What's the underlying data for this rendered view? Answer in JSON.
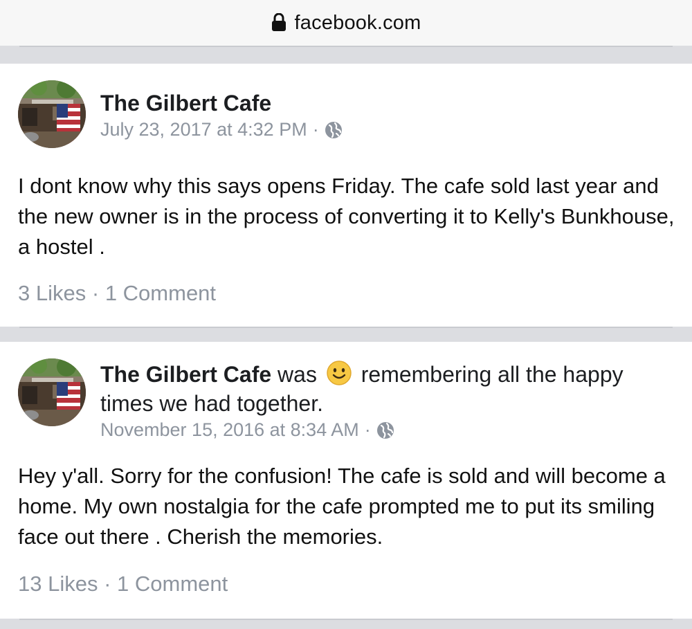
{
  "browser": {
    "url": "facebook.com",
    "lock_icon": "lock-icon"
  },
  "posts": [
    {
      "author": "The Gilbert Cafe",
      "activity": "",
      "activity_rest": "",
      "timestamp": "July 23, 2017 at 4:32 PM",
      "separator": "·",
      "privacy_icon": "globe-icon",
      "body": "I dont know why this says opens Friday. The cafe sold last year and the new owner is in the process of converting it to Kelly's Bunkhouse, a hostel .",
      "likes": "3 Likes",
      "stats_separator": "·",
      "comments": "1 Comment"
    },
    {
      "author": "The Gilbert Cafe",
      "activity": "was",
      "activity_rest": "remembering all the happy times we had together.",
      "feeling_icon": "smiley-face-icon",
      "timestamp": "November 15, 2016 at 8:34 AM",
      "separator": "·",
      "privacy_icon": "globe-icon",
      "body": "Hey y'all. Sorry for the confusion! The cafe is sold and will become a home. My own nostalgia for the cafe prompted me to put its smiling face out there . Cherish the memories.",
      "likes": "13 Likes",
      "stats_separator": "·",
      "comments": "1 Comment"
    }
  ],
  "colors": {
    "meta_gray": "#8d949e",
    "separator_gray": "#dcdde1",
    "text": "#1c1e21"
  }
}
